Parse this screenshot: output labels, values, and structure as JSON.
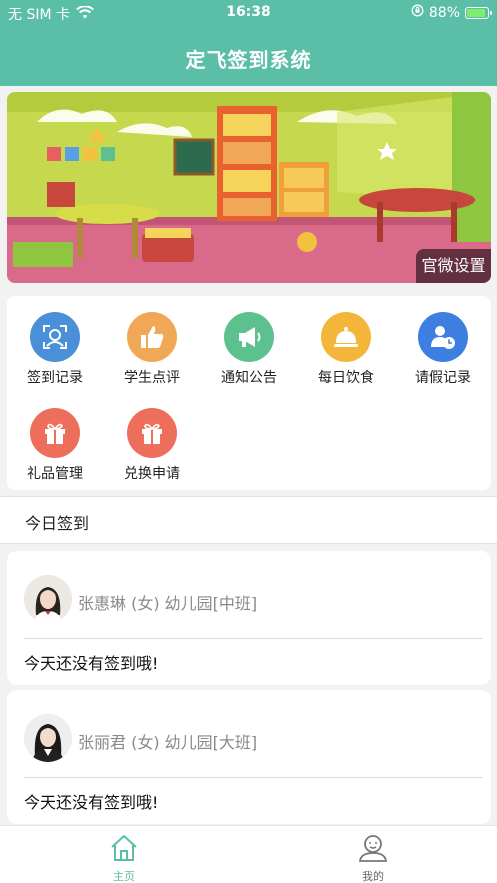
{
  "status_bar": {
    "carrier": "无 SIM 卡",
    "time": "16:38",
    "battery": "88%"
  },
  "header": {
    "title": "定飞签到系统"
  },
  "banner": {
    "button_label": "官微设置"
  },
  "menu": [
    {
      "label": "签到记录",
      "icon": "face-scan-icon",
      "color": "#4a90d9"
    },
    {
      "label": "学生点评",
      "icon": "thumbs-up-icon",
      "color": "#f0a857"
    },
    {
      "label": "通知公告",
      "icon": "megaphone-icon",
      "color": "#5cc18f"
    },
    {
      "label": "每日饮食",
      "icon": "food-bell-icon",
      "color": "#f4b63a"
    },
    {
      "label": "请假记录",
      "icon": "user-clock-icon",
      "color": "#3d7fe0"
    },
    {
      "label": "礼品管理",
      "icon": "gift-icon",
      "color": "#ee6e5c"
    },
    {
      "label": "兑换申请",
      "icon": "gift-icon",
      "color": "#ee6e5c"
    }
  ],
  "section": {
    "title": "今日签到"
  },
  "students": [
    {
      "info": "张惠琳 (女) 幼儿园[中班]",
      "status": "今天还没有签到哦!"
    },
    {
      "info": "张丽君 (女) 幼儿园[大班]",
      "status": "今天还没有签到哦!"
    }
  ],
  "tabbar": {
    "active_color": "#5bbfa8",
    "items": [
      {
        "label": "主页",
        "icon": "home-icon"
      },
      {
        "label": "我的",
        "icon": "profile-icon"
      }
    ]
  }
}
